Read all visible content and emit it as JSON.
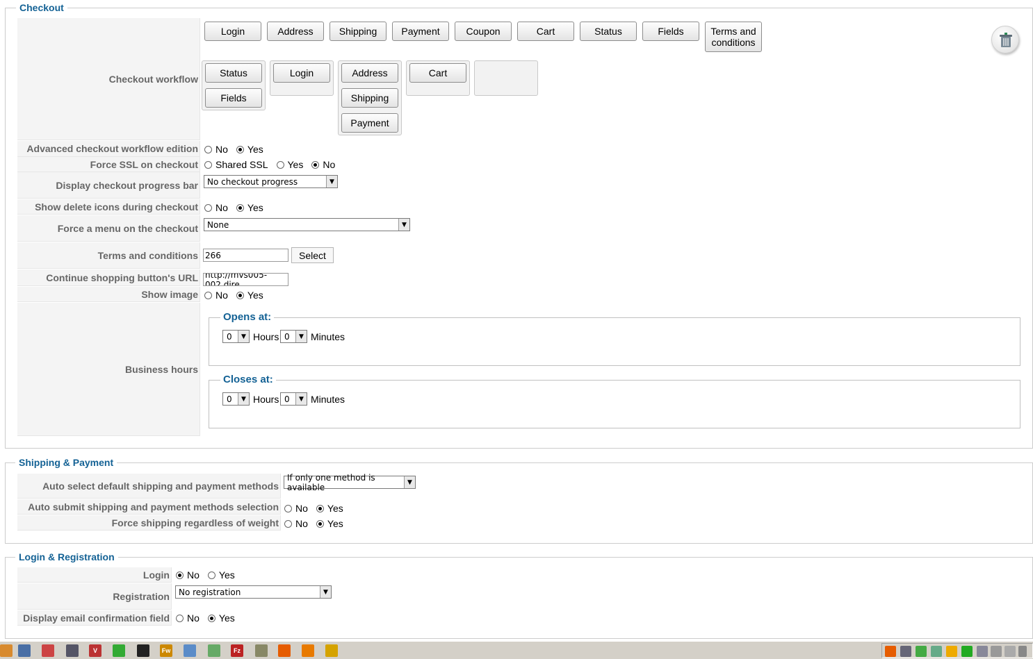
{
  "checkout": {
    "legend": "Checkout",
    "workflow_label": "Checkout workflow",
    "available_steps": [
      "Login",
      "Address",
      "Shipping",
      "Payment",
      "Coupon",
      "Cart",
      "Status",
      "Fields",
      "Terms and conditions"
    ],
    "workflow_groups": [
      [
        "Status",
        "Fields"
      ],
      [
        "Login"
      ],
      [
        "Address",
        "Shipping",
        "Payment"
      ],
      [
        "Cart"
      ],
      []
    ],
    "advanced_label": "Advanced checkout workflow edition",
    "advanced": {
      "no": "No",
      "yes": "Yes",
      "selected": "Yes"
    },
    "ssl_label": "Force SSL on checkout",
    "ssl": {
      "shared": "Shared SSL",
      "yes": "Yes",
      "no": "No",
      "selected": "No"
    },
    "progress_label": "Display checkout progress bar",
    "progress_value": "No checkout progress",
    "delete_icons_label": "Show delete icons during checkout",
    "delete_icons": {
      "no": "No",
      "yes": "Yes",
      "selected": "Yes"
    },
    "menu_label": "Force a menu on the checkout",
    "menu_value": "None",
    "terms_label": "Terms and conditions",
    "terms_value": "266",
    "select_button": "Select",
    "continue_label": "Continue shopping button's URL",
    "continue_value": "http://mvs005-002.dire",
    "show_image_label": "Show image",
    "show_image": {
      "no": "No",
      "yes": "Yes",
      "selected": "Yes"
    },
    "business_label": "Business hours",
    "opens_legend": "Opens at:",
    "closes_legend": "Closes at:",
    "opens": {
      "hours": "0",
      "minutes": "0"
    },
    "closes": {
      "hours": "0",
      "minutes": "0"
    },
    "hours_text": "Hours",
    "minutes_text": "Minutes"
  },
  "shipping": {
    "legend": "Shipping & Payment",
    "auto_select_label": "Auto select default shipping and payment methods",
    "auto_select_value": "If only one method is available",
    "auto_submit_label": "Auto submit shipping and payment methods selection",
    "auto_submit": {
      "no": "No",
      "yes": "Yes",
      "selected": "Yes"
    },
    "force_label": "Force shipping regardless of weight",
    "force": {
      "no": "No",
      "yes": "Yes",
      "selected": "Yes"
    }
  },
  "login": {
    "legend": "Login & Registration",
    "login_label": "Login",
    "login": {
      "no": "No",
      "yes": "Yes",
      "selected": "No"
    },
    "registration_label": "Registration",
    "registration_value": "No registration",
    "email_label": "Display email confirmation field",
    "email": {
      "no": "No",
      "yes": "Yes",
      "selected": "Yes"
    }
  },
  "taskbar": {
    "icons": [
      "app-icon",
      "browser-icon",
      "search-icon",
      "tools-icon",
      "editor-icon",
      "paint-icon",
      "terminal-icon",
      "fireworks-icon",
      "document-icon",
      "photo-icon",
      "filezilla-icon",
      "utility-icon",
      "xampp-icon",
      "firefox-icon",
      "notepad-icon"
    ],
    "tray_icons": [
      "xampp-tray-icon",
      "network-tray-icon",
      "sync-tray-icon",
      "monitor-tray-icon",
      "update-tray-icon",
      "security-tray-icon",
      "display-tray-icon",
      "flag-tray-icon",
      "keyboard-tray-icon",
      "volume-tray-icon",
      "expand-tray-icon"
    ]
  }
}
